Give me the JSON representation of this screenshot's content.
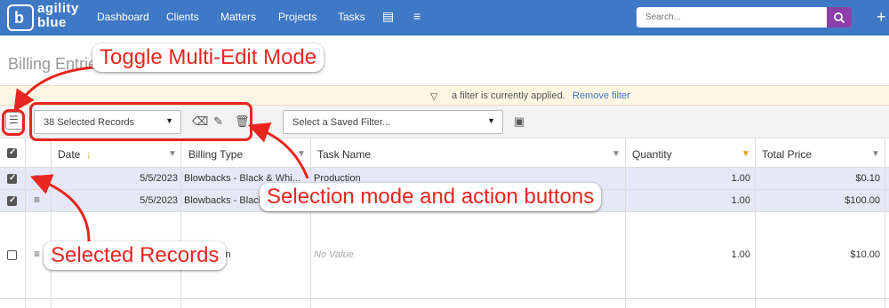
{
  "nav": {
    "logo_line1": "agility",
    "logo_line2": "blue",
    "items": [
      "Dashboard",
      "Clients",
      "Matters",
      "Projects",
      "Tasks"
    ],
    "search_placeholder": "Search...",
    "add_icon": "plus-icon"
  },
  "page": {
    "title": "Billing Entries"
  },
  "filter": {
    "text": "a filter is currently applied.",
    "link": "Remove filter"
  },
  "toolbar": {
    "selected_records": "38 Selected Records",
    "saved_filter_placeholder": "Select a Saved Filter..."
  },
  "grid": {
    "columns": [
      "Date",
      "Billing Type",
      "Task Name",
      "Quantity",
      "Total Price"
    ],
    "rows": [
      {
        "selected": true,
        "date": "5/5/2023",
        "billing_type": "Blowbacks - Black & Whi...",
        "task_name": "Production",
        "quantity": "1.00",
        "total_price": "$0.10"
      },
      {
        "selected": true,
        "date": "5/5/2023",
        "billing_type": "Blowbacks - Black & Whi...",
        "task_name": "",
        "quantity": "1.00",
        "total_price": "$100.00"
      },
      {
        "selected": false,
        "date": "",
        "billing_type": "Production",
        "task_name": "No Value",
        "quantity": "1.00",
        "total_price": "$10.00"
      }
    ]
  },
  "annotations": {
    "toggle": "Toggle Multi-Edit Mode",
    "selection": "Selection mode and action buttons",
    "selected": "Selected Records"
  },
  "colors": {
    "nav_bg": "#3f78c4",
    "search_btn": "#8b3fa9",
    "annotation": "#e8251f",
    "selected_row": "#e6e8f7"
  }
}
